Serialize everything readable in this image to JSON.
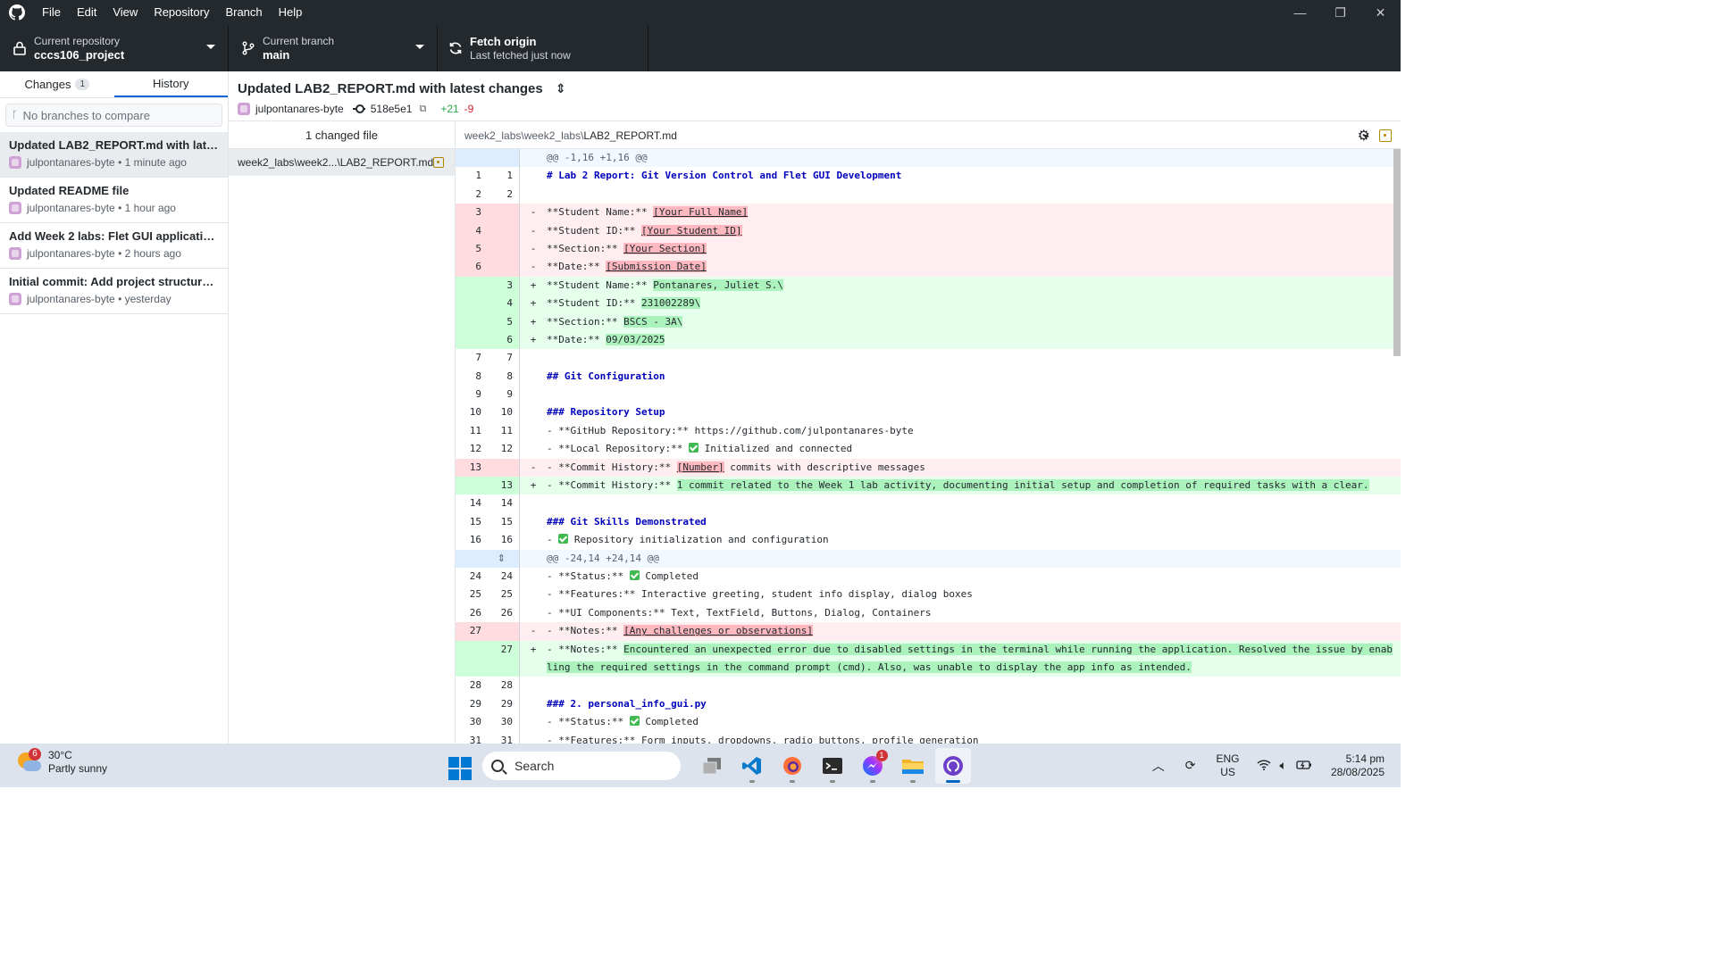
{
  "menu": [
    "File",
    "Edit",
    "View",
    "Repository",
    "Branch",
    "Help"
  ],
  "toolbar": {
    "repo_label": "Current repository",
    "repo_value": "cccs106_project",
    "branch_label": "Current branch",
    "branch_value": "main",
    "fetch_label": "Fetch origin",
    "fetch_sub": "Last fetched just now"
  },
  "sidebar": {
    "tab_changes": "Changes",
    "changes_count": "1",
    "tab_history": "History",
    "compare_placeholder": "No branches to compare",
    "commits": [
      {
        "title": "Updated LAB2_REPORT.md with latest ...",
        "meta": "julpontanares-byte • 1 minute ago"
      },
      {
        "title": "Updated README file",
        "meta": "julpontanares-byte • 1 hour ago"
      },
      {
        "title": "Add Week 2 labs: Flet GUI applications",
        "meta": "julpontanares-byte • 2 hours ago"
      },
      {
        "title": "Initial commit: Add project structure an...",
        "meta": "julpontanares-byte • yesterday"
      }
    ]
  },
  "commit": {
    "title": "Updated LAB2_REPORT.md with latest changes",
    "author": "julpontanares-byte",
    "sha": "518e5e1",
    "additions": "+21",
    "deletions": "-9"
  },
  "files": {
    "header": "1 changed file",
    "items": [
      "week2_labs\\week2...\\LAB2_REPORT.md"
    ]
  },
  "diff": {
    "path_dir": "week2_labs\\week2_labs\\",
    "path_file": "LAB2_REPORT.md",
    "lines": [
      {
        "t": "hunk",
        "o": "",
        "n": "",
        "m": "",
        "c": "@@ -1,16 +1,16 @@"
      },
      {
        "t": "ctx",
        "o": "1",
        "n": "1",
        "m": "",
        "c": "# Lab 2 Report: Git Version Control and Flet GUI Development",
        "kw": true
      },
      {
        "t": "ctx",
        "o": "2",
        "n": "2",
        "m": "",
        "c": ""
      },
      {
        "t": "del",
        "o": "3",
        "n": "",
        "m": "-",
        "c": "**Student Name:** ",
        "h": "[Your Full Name]"
      },
      {
        "t": "del",
        "o": "4",
        "n": "",
        "m": "-",
        "c": "**Student ID:** ",
        "h": "[Your Student ID]"
      },
      {
        "t": "del",
        "o": "5",
        "n": "",
        "m": "-",
        "c": "**Section:** ",
        "h": "[Your Section]"
      },
      {
        "t": "del",
        "o": "6",
        "n": "",
        "m": "-",
        "c": "**Date:** ",
        "h": "[Submission Date]"
      },
      {
        "t": "add",
        "o": "",
        "n": "3",
        "m": "+",
        "c": "**Student Name:** ",
        "h": "Pontanares, Juliet S.\\"
      },
      {
        "t": "add",
        "o": "",
        "n": "4",
        "m": "+",
        "c": "**Student ID:** ",
        "h": "231002289\\"
      },
      {
        "t": "add",
        "o": "",
        "n": "5",
        "m": "+",
        "c": "**Section:** ",
        "h": "BSCS - 3A\\"
      },
      {
        "t": "add",
        "o": "",
        "n": "6",
        "m": "+",
        "c": "**Date:** ",
        "h": "09/03/2025"
      },
      {
        "t": "ctx",
        "o": "7",
        "n": "7",
        "m": "",
        "c": ""
      },
      {
        "t": "ctx",
        "o": "8",
        "n": "8",
        "m": "",
        "c": "## Git Configuration",
        "kw": true
      },
      {
        "t": "ctx",
        "o": "9",
        "n": "9",
        "m": "",
        "c": ""
      },
      {
        "t": "ctx",
        "o": "10",
        "n": "10",
        "m": "",
        "c": "### Repository Setup",
        "kw": true
      },
      {
        "t": "ctx",
        "o": "11",
        "n": "11",
        "m": "",
        "c": "- **GitHub Repository:** https://github.com/julpontanares-byte"
      },
      {
        "t": "ctx",
        "o": "12",
        "n": "12",
        "m": "",
        "c": "- **Local Repository:** ",
        "chk": true,
        "after": " Initialized and connected"
      },
      {
        "t": "del",
        "o": "13",
        "n": "",
        "m": "-",
        "c": "- **Commit History:** ",
        "h": "[Number]",
        "after": " commits with descriptive messages"
      },
      {
        "t": "add",
        "o": "",
        "n": "13",
        "m": "+",
        "c": "- **Commit History:** ",
        "h": "1 commit related to the Week 1 lab activity, documenting initial setup and completion of required tasks with a clear."
      },
      {
        "t": "ctx",
        "o": "14",
        "n": "14",
        "m": "",
        "c": ""
      },
      {
        "t": "ctx",
        "o": "15",
        "n": "15",
        "m": "",
        "c": "### Git Skills Demonstrated",
        "kw": true
      },
      {
        "t": "ctx",
        "o": "16",
        "n": "16",
        "m": "",
        "c": "- ",
        "chk": true,
        "after": " Repository initialization and configuration"
      },
      {
        "t": "hunk",
        "o": "",
        "n": "",
        "m": "",
        "c": "@@ -24,14 +24,14 @@"
      },
      {
        "t": "ctx",
        "o": "24",
        "n": "24",
        "m": "",
        "c": "- **Status:** ",
        "chk": true,
        "after": " Completed"
      },
      {
        "t": "ctx",
        "o": "25",
        "n": "25",
        "m": "",
        "c": "- **Features:** Interactive greeting, student info display, dialog boxes"
      },
      {
        "t": "ctx",
        "o": "26",
        "n": "26",
        "m": "",
        "c": "- **UI Components:** Text, TextField, Buttons, Dialog, Containers"
      },
      {
        "t": "del",
        "o": "27",
        "n": "",
        "m": "-",
        "c": "- **Notes:** ",
        "h": "[Any challenges or observations]"
      },
      {
        "t": "add",
        "o": "",
        "n": "27",
        "m": "+",
        "c": "- **Notes:** ",
        "h": "Encountered an unexpected error due to disabled settings in the terminal while running the application. Resolved the issue by enabling the required settings in the command prompt (cmd). Also, was unable to display the app info as intended.",
        "tall": true
      },
      {
        "t": "ctx",
        "o": "28",
        "n": "28",
        "m": "",
        "c": ""
      },
      {
        "t": "ctx",
        "o": "29",
        "n": "29",
        "m": "",
        "c": "### 2. personal_info_gui.py",
        "kw": true
      },
      {
        "t": "ctx",
        "o": "30",
        "n": "30",
        "m": "",
        "c": "- **Status:** ",
        "chk": true,
        "after": " Completed"
      },
      {
        "t": "ctx",
        "o": "31",
        "n": "31",
        "m": "",
        "c": "- **Features:** Form inputs, dropdowns, radio buttons, profile generation"
      }
    ]
  },
  "taskbar": {
    "temp": "30°C",
    "weather": "Partly sunny",
    "weather_badge": "6",
    "search_placeholder": "Search",
    "messenger_badge": "1",
    "lang1": "ENG",
    "lang2": "US",
    "time": "5:14 pm",
    "date": "28/08/2025"
  }
}
